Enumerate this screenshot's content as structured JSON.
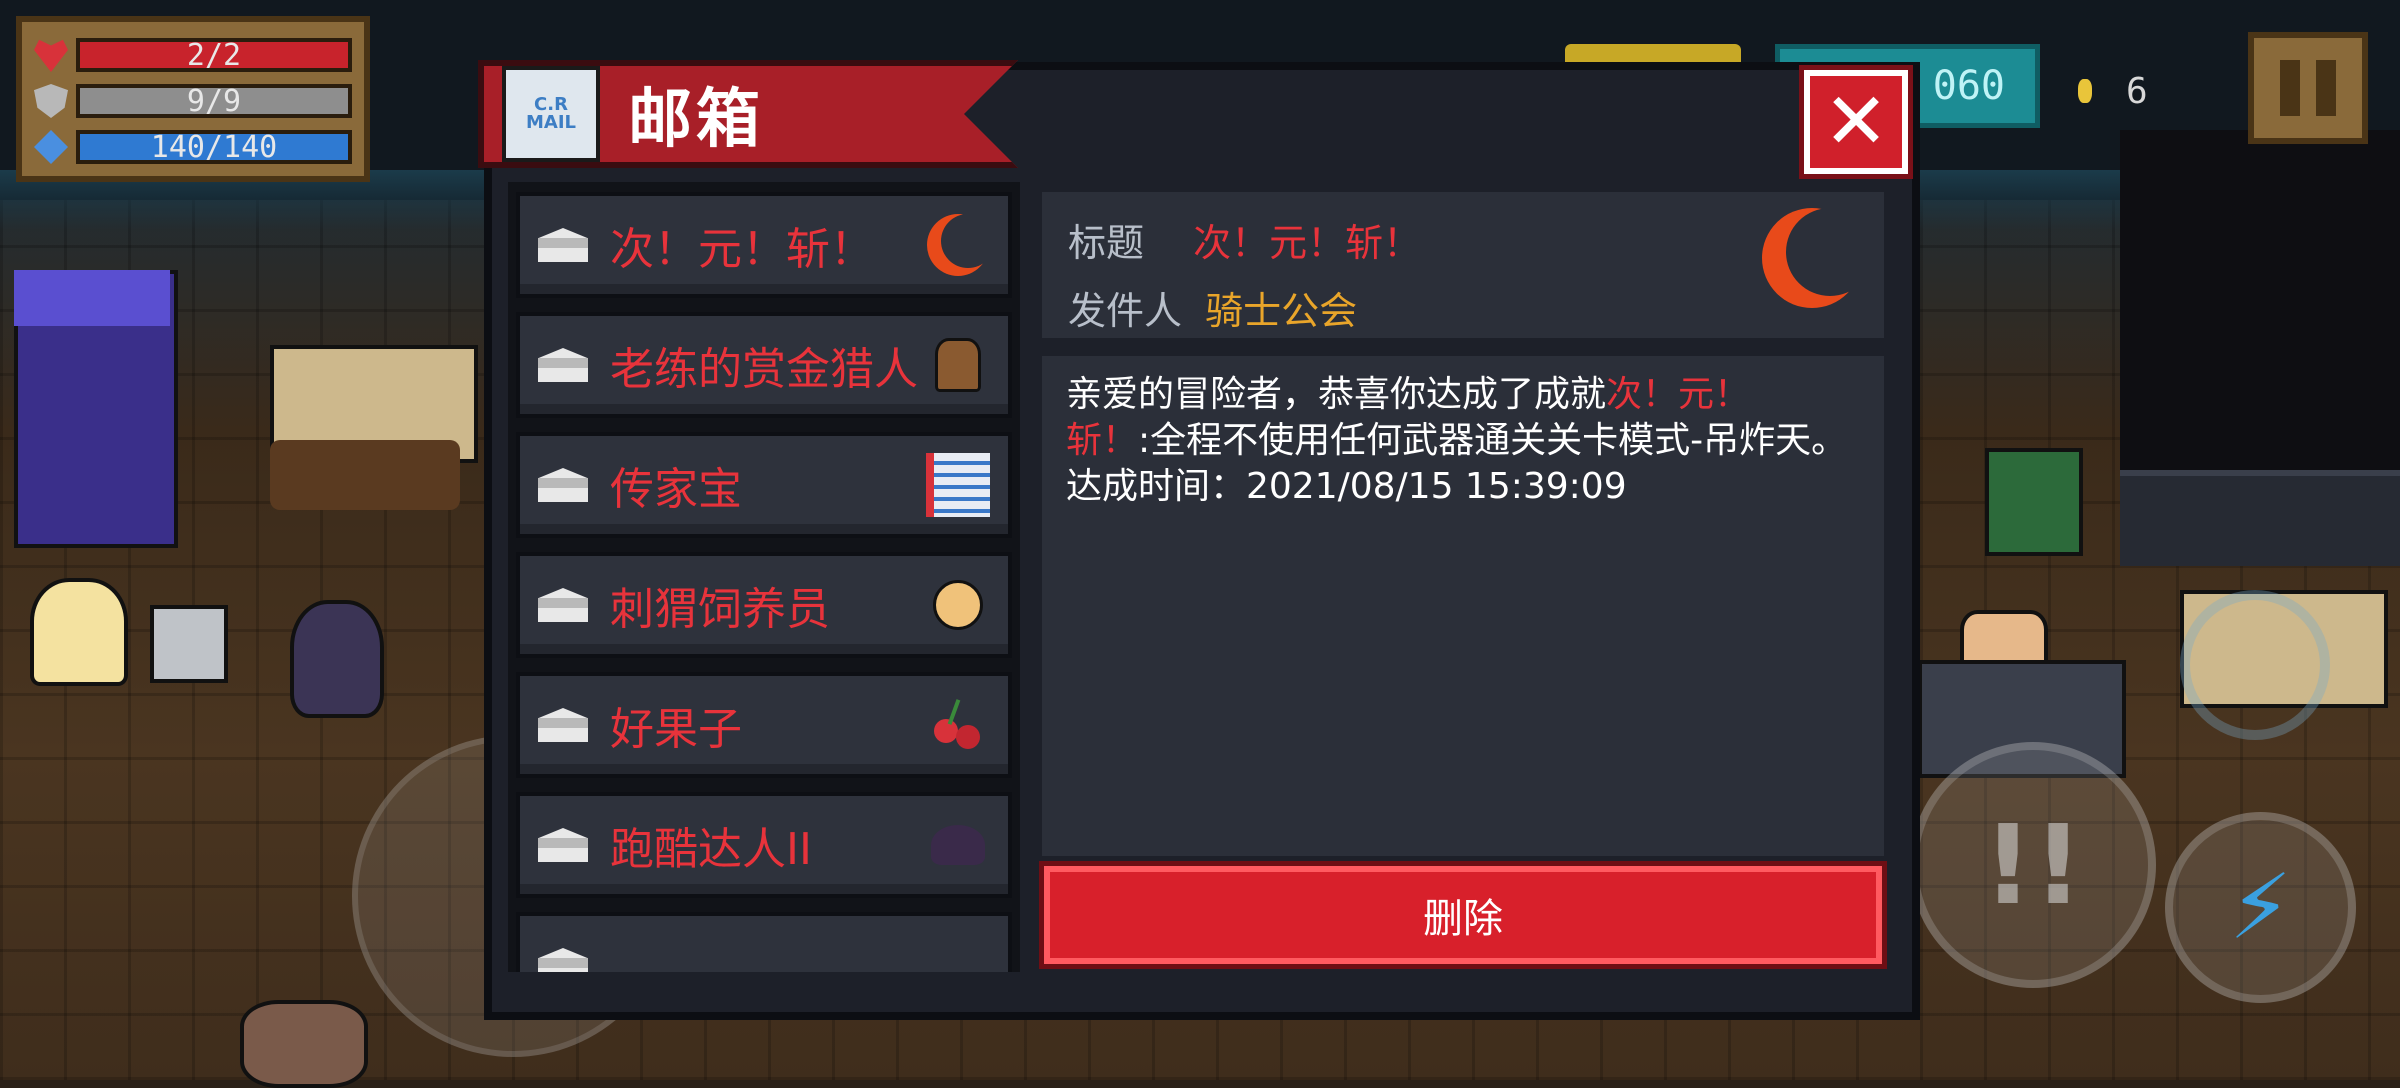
{
  "hud": {
    "hp": "2/2",
    "armor": "9/9",
    "energy": "140/140"
  },
  "top_right": {
    "gems": "060",
    "coins": "6"
  },
  "mailbox": {
    "title": "邮箱",
    "icon_text": "C.R MAIL",
    "mails": [
      {
        "label": "次！元！斩！",
        "icon": "crescent-moon-icon"
      },
      {
        "label": "老练的赏金猎人",
        "icon": "bounty-hunter-icon"
      },
      {
        "label": "传家宝",
        "icon": "document-icon"
      },
      {
        "label": "刺猬饲养员",
        "icon": "cupid-icon"
      },
      {
        "label": "好果子",
        "icon": "cherry-icon"
      },
      {
        "label": "跑酷达人II",
        "icon": "shadow-creature-icon"
      },
      {
        "label": "",
        "icon": "partial-item-icon"
      }
    ],
    "detail": {
      "title_label": "标题",
      "title_value": "次！元！斩！",
      "sender_label": "发件人",
      "sender_value": "骑士公会",
      "body_intro": "亲爱的冒险者，恭喜你达成了成就",
      "body_achievement_part1": "次！元！",
      "body_achievement_part2": "斩！",
      "body_desc": ":全程不使用任何武器通关关卡模式-吊炸天。",
      "body_time": "达成时间：2021/08/15 15:39:09"
    },
    "delete_label": "删除",
    "close_label": "✕"
  },
  "colors": {
    "accent_red": "#d8202b",
    "text_red": "#e8333b",
    "sender_orange": "#e9a52a"
  }
}
